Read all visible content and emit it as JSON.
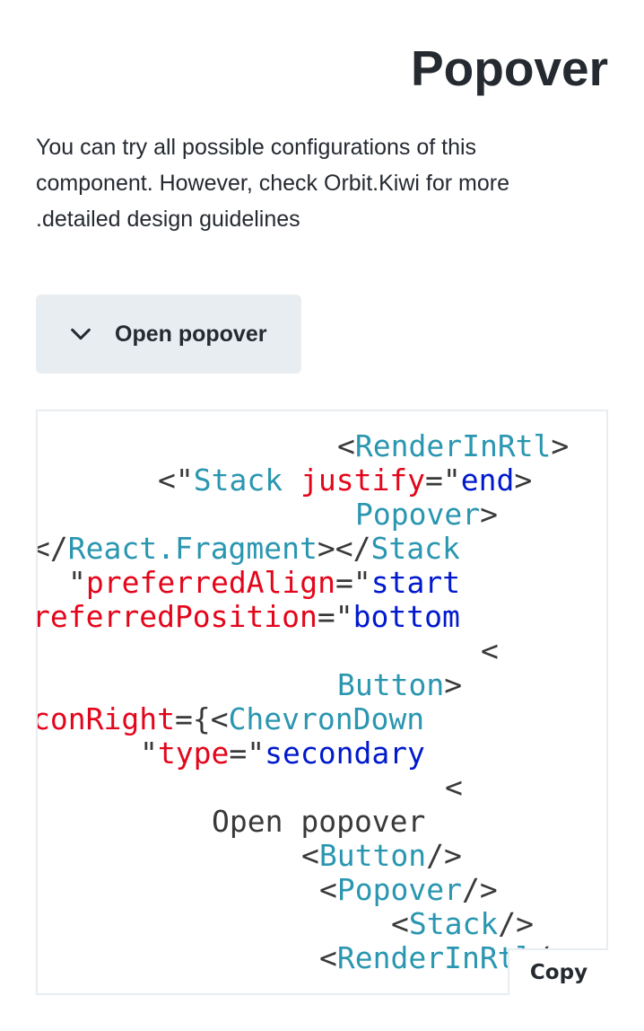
{
  "header": {
    "title": "Popover"
  },
  "description": {
    "lines": [
      "You can try all possible configurations of this",
      "component. However, check Orbit.Kiwi for more",
      ".detailed design guidelines"
    ]
  },
  "demo": {
    "button_label": "Open popover",
    "button_icon": "chevron-down-icon"
  },
  "code": {
    "lines": [
      [
        [
          "<",
          "p"
        ],
        [
          "RenderInRtl",
          "t"
        ],
        [
          ">",
          "p"
        ]
      ],
      [
        [
          "<\"",
          "p"
        ],
        [
          "Stack ",
          "t"
        ],
        [
          "justify",
          "a"
        ],
        [
          "=\"",
          "p"
        ],
        [
          "end",
          "v"
        ],
        [
          ">",
          "p"
        ]
      ],
      [
        [
          "Popover",
          "t"
        ],
        [
          ">",
          "p"
        ]
      ],
      [
        [
          "</",
          "p"
        ],
        [
          "React.Fragment",
          "t"
        ],
        [
          "></",
          "p"
        ],
        [
          "Stack",
          "t"
        ]
      ],
      [
        [
          "\"",
          "p"
        ],
        [
          "preferredAlign",
          "a"
        ],
        [
          "=\"",
          "p"
        ],
        [
          "start",
          "v"
        ]
      ],
      [
        [
          "referredPosition",
          "a"
        ],
        [
          "=\"",
          "p"
        ],
        [
          "bottom",
          "v"
        ]
      ],
      [
        [
          "<",
          "p"
        ]
      ],
      [
        [
          "Button",
          "t"
        ],
        [
          ">",
          "p"
        ]
      ],
      [
        [
          "conRight",
          "a"
        ],
        [
          "={<",
          "p"
        ],
        [
          "ChevronDown",
          "t"
        ]
      ],
      [
        [
          "\"",
          "p"
        ],
        [
          "type",
          "a"
        ],
        [
          "=\"",
          "p"
        ],
        [
          "secondary",
          "v"
        ]
      ],
      [
        [
          "<",
          "p"
        ]
      ],
      [
        [
          "Open popover",
          "x"
        ]
      ],
      [
        [
          "<",
          "p"
        ],
        [
          "Button",
          "t"
        ],
        [
          "/>",
          "p"
        ]
      ],
      [
        [
          "<",
          "p"
        ],
        [
          "Popover",
          "t"
        ],
        [
          "/>",
          "p"
        ]
      ],
      [
        [
          "<",
          "p"
        ],
        [
          "Stack",
          "t"
        ],
        [
          "/>",
          "p"
        ]
      ],
      [
        [
          "<",
          "p"
        ],
        [
          "RenderInRtl",
          "t"
        ],
        [
          "/>",
          "p"
        ]
      ]
    ],
    "copy_label": "Copy"
  }
}
